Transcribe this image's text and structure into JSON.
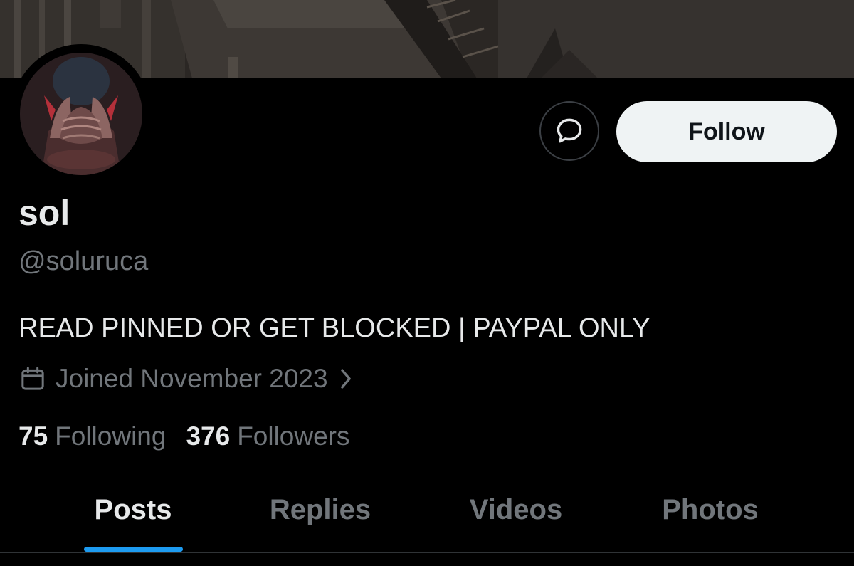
{
  "profile": {
    "display_name": "sol",
    "handle": "@soluruca",
    "bio": "READ PINNED OR GET BLOCKED | PAYPAL ONLY",
    "joined": "Joined November 2023"
  },
  "actions": {
    "message_icon": "message-bubble-icon",
    "follow_label": "Follow"
  },
  "stats": {
    "following_count": "75",
    "following_label": "Following",
    "followers_count": "376",
    "followers_label": "Followers"
  },
  "tabs": [
    {
      "label": "Posts",
      "active": true
    },
    {
      "label": "Replies",
      "active": false
    },
    {
      "label": "Videos",
      "active": false
    },
    {
      "label": "Photos",
      "active": false
    }
  ],
  "colors": {
    "background": "#000000",
    "text_primary": "#e7e9ea",
    "text_secondary": "#71767b",
    "accent": "#1d9bf0",
    "follow_button_bg": "#eff3f4"
  }
}
